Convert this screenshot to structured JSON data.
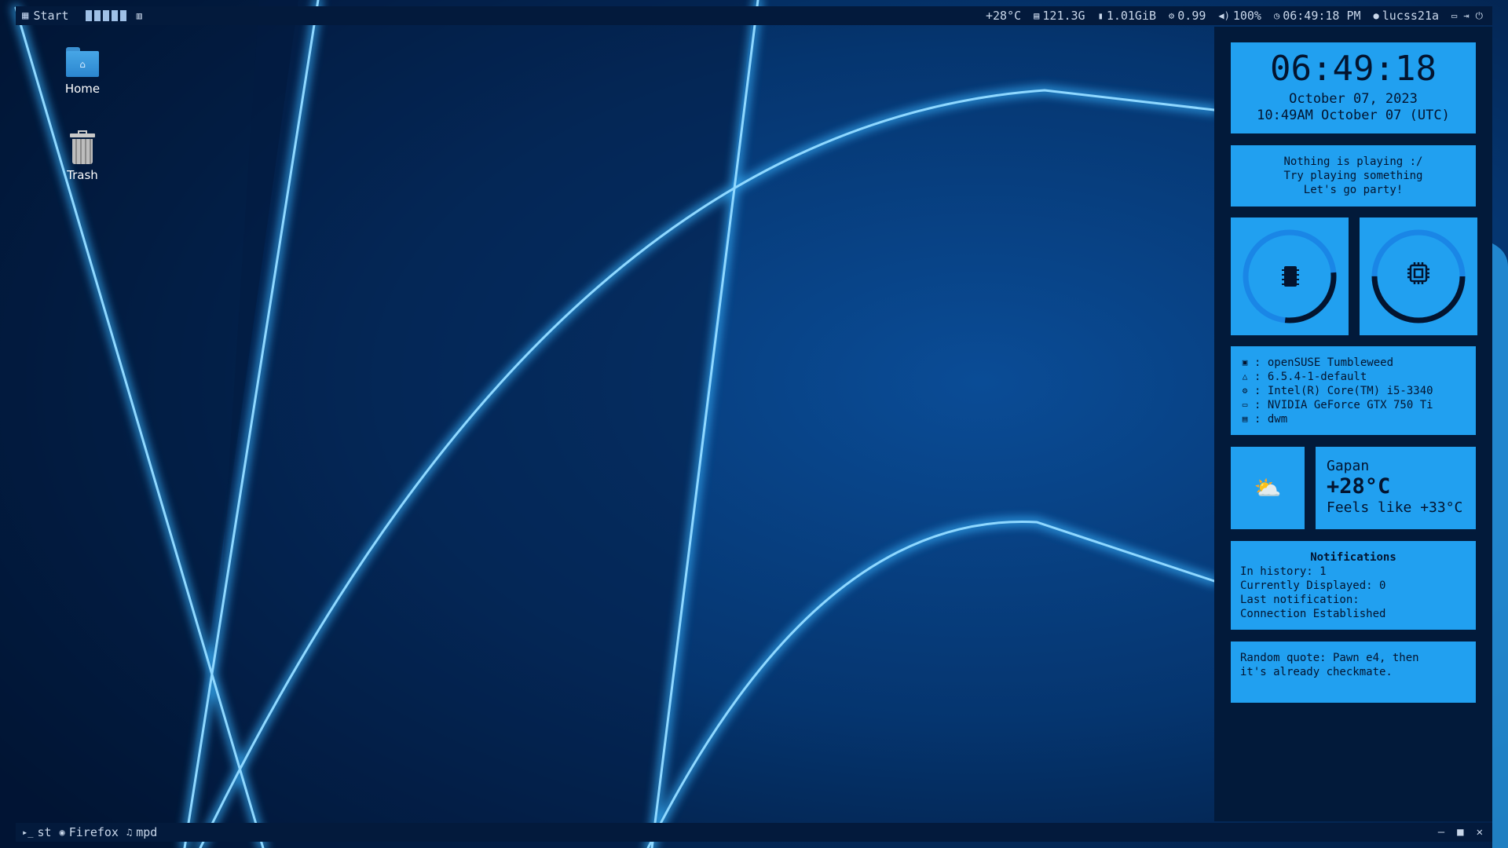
{
  "topbar": {
    "start_label": "Start",
    "status": [
      {
        "icon": "thermometer-icon",
        "value": "+28°C"
      },
      {
        "icon": "disk-icon",
        "value": "121.3G"
      },
      {
        "icon": "memory-icon",
        "value": "1.01GiB"
      },
      {
        "icon": "cpu-icon",
        "value": "0.99"
      },
      {
        "icon": "volume-icon",
        "value": "100%"
      },
      {
        "icon": "clock-icon",
        "value": "06:49:18 PM"
      },
      {
        "icon": "user-icon",
        "value": "lucss21a"
      }
    ]
  },
  "desktop": {
    "icons": [
      {
        "label": "Home",
        "icon": "home-folder-icon"
      },
      {
        "label": "Trash",
        "icon": "trash-icon"
      }
    ]
  },
  "sidebar": {
    "clock": {
      "time": "06:49:18",
      "date": "October 07, 2023",
      "utc": "10:49AM October 07 (UTC)"
    },
    "music": {
      "line1": "Nothing is playing :/",
      "line2": "Try playing something",
      "line3": "Let's go party!"
    },
    "gauges": {
      "memory_fraction": 0.28,
      "cpu_fraction": 0.5
    },
    "sysinfo": [
      {
        "icon": "distro-icon",
        "text": ": openSUSE Tumbleweed"
      },
      {
        "icon": "kernel-icon",
        "text": ": 6.5.4-1-default"
      },
      {
        "icon": "cpu-icon",
        "text": ": Intel(R) Core(TM) i5-3340"
      },
      {
        "icon": "monitor-icon",
        "text": ": NVIDIA GeForce GTX 750 Ti"
      },
      {
        "icon": "window-icon",
        "text": ": dwm"
      }
    ],
    "weather": {
      "city": "Gapan",
      "temp": "+28°C",
      "feels": "Feels like +33°C",
      "icon": "⛅"
    },
    "notifications": {
      "title": "Notifications",
      "history": "In history: 1",
      "displayed": "Currently Displayed: 0",
      "last_label": "Last notification:",
      "last_value": "Connection Established"
    },
    "quote": {
      "line1": "Random quote: Pawn e4, then",
      "line2": "it's already checkmate."
    }
  },
  "bottombar": {
    "tasks": [
      {
        "label": "st",
        "icon": "terminal-icon"
      },
      {
        "label": "Firefox",
        "icon": "firefox-icon"
      },
      {
        "label": "mpd",
        "icon": "music-note-icon"
      }
    ]
  },
  "colors": {
    "accent": "#21a0f0",
    "bar": "#031a3c",
    "gauge_track": "#1a86e6",
    "gauge_fill": "#03142f"
  }
}
